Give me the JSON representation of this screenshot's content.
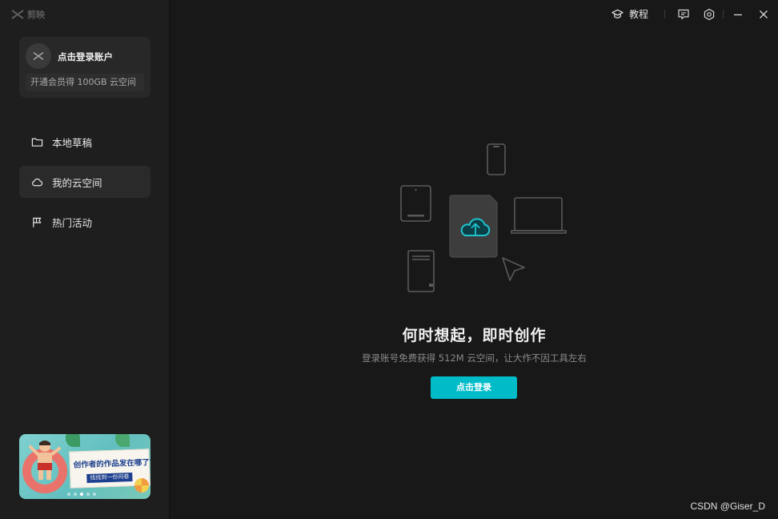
{
  "app": {
    "name": "剪映"
  },
  "account": {
    "login_label": "点击登录账户",
    "vip_promo": "开通会员得 100GB 云空间"
  },
  "nav": {
    "items": [
      {
        "label": "本地草稿",
        "icon": "folder-icon",
        "active": false
      },
      {
        "label": "我的云空间",
        "icon": "cloud-icon",
        "active": true
      },
      {
        "label": "热门活动",
        "icon": "flag-icon",
        "active": false
      }
    ]
  },
  "banner": {
    "title": "创作者的作品发在哪了?",
    "tag": "找找到一份问卷"
  },
  "topbar": {
    "tutorial_label": "教程",
    "icons": [
      "feedback-icon",
      "settings-icon",
      "minimize-icon",
      "close-icon"
    ]
  },
  "main": {
    "headline": "何时想起，即时创作",
    "subtitle": "登录账号免费获得 512M 云空间，让大作不因工具左右",
    "login_button": "点击登录"
  },
  "colors": {
    "accent": "#00bcc8",
    "background": "#181818",
    "sidebar": "#1e1e1e",
    "card": "#282828"
  },
  "watermark": "CSDN @Giser_D"
}
